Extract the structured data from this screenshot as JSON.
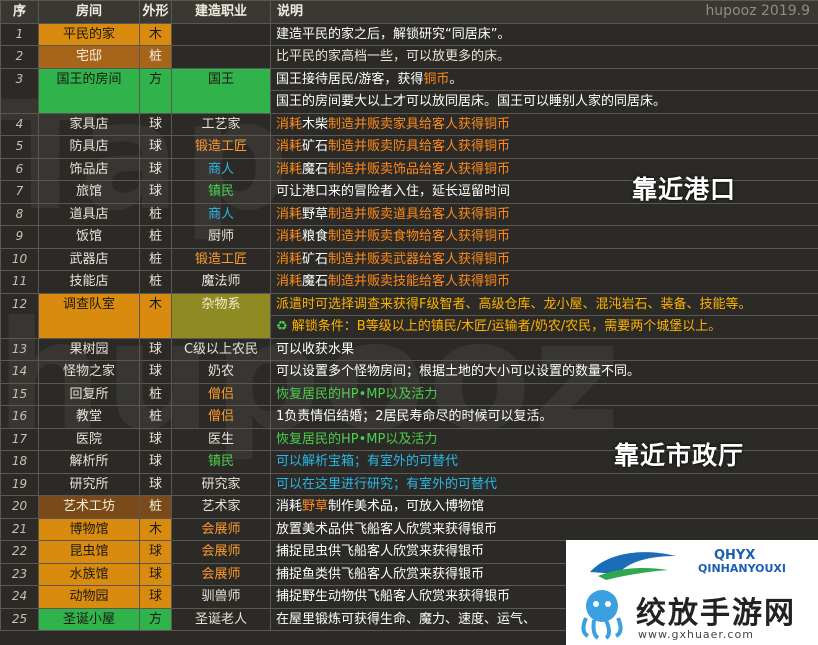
{
  "brand": "hupooz 2019.9",
  "headers": {
    "no": "序",
    "room": "房间",
    "shape": "外形",
    "job": "建造职业",
    "desc": "说明"
  },
  "rows": [
    {
      "no": "1",
      "room": "平民的家",
      "shape": "木",
      "job": "",
      "desc": "建造平民的家之后，解锁研究“同居床”。"
    },
    {
      "no": "2",
      "room": "宅邸",
      "shape": "桩",
      "job": "",
      "desc": "比平民的家高档一些，可以放更多的床。"
    },
    {
      "no": "3",
      "room": "国王的房间",
      "shape": "方",
      "job": "国王",
      "desc_a": "国王接待居民/游客，获得",
      "desc_b": "铜币",
      "desc_c": "。",
      "desc2": "国王的房间要大以上才可以放同居床。国王可以睡别人家的同居床。"
    },
    {
      "no": "4",
      "room": "家具店",
      "shape": "球",
      "job": "工艺家",
      "desc_a": "消耗",
      "desc_b": "木柴",
      "desc_c": "制造并贩卖家具给客人获得铜币"
    },
    {
      "no": "5",
      "room": "防具店",
      "shape": "球",
      "job": "锻造工匠",
      "desc_a": "消耗",
      "desc_b": "矿石",
      "desc_c": "制造并贩卖防具给客人获得铜币"
    },
    {
      "no": "6",
      "room": "饰品店",
      "shape": "球",
      "job": "商人",
      "desc_a": "消耗",
      "desc_b": "魔石",
      "desc_c": "制造并贩卖饰品给客人获得铜币"
    },
    {
      "no": "7",
      "room": "旅馆",
      "shape": "球",
      "job": "镇民",
      "desc": "可让港口来的冒险者入住，延长逗留时间"
    },
    {
      "no": "8",
      "room": "道具店",
      "shape": "桩",
      "job": "商人",
      "desc_a": "消耗",
      "desc_b": "野草",
      "desc_c": "制造并贩卖道具给客人获得铜币"
    },
    {
      "no": "9",
      "room": "饭馆",
      "shape": "桩",
      "job": "厨师",
      "desc_a": "消耗",
      "desc_b": "粮食",
      "desc_c": "制造并贩卖食物给客人获得铜币"
    },
    {
      "no": "10",
      "room": "武器店",
      "shape": "桩",
      "job": "锻造工匠",
      "desc_a": "消耗",
      "desc_b": "矿石",
      "desc_c": "制造并贩卖武器给客人获得铜币"
    },
    {
      "no": "11",
      "room": "技能店",
      "shape": "桩",
      "job": "魔法师",
      "desc_a": "消耗",
      "desc_b": "魔石",
      "desc_c": "制造并贩卖技能给客人获得铜币"
    },
    {
      "no": "12",
      "room": "调查队室",
      "shape": "木",
      "job": "杂物系",
      "desc": "派遣时可选择调查来获得F级智者、高级仓库、龙小屋、混沌岩石、装备、技能等。",
      "desc2_icon": "♻",
      "desc2": "解锁条件：B等级以上的镇民/木匠/运输者/奶农/农民，需要两个城堡以上。"
    },
    {
      "no": "13",
      "room": "果树园",
      "shape": "球",
      "job": "C级以上农民",
      "desc": "可以收获水果"
    },
    {
      "no": "14",
      "room": "怪物之家",
      "shape": "球",
      "job": "奶农",
      "desc": "可以设置多个怪物房间；根据土地的大小可以设置的数量不同。"
    },
    {
      "no": "15",
      "room": "回复所",
      "shape": "桩",
      "job": "僧侣",
      "desc": "恢复居民的HP•MP以及活力"
    },
    {
      "no": "16",
      "room": "教堂",
      "shape": "桩",
      "job": "僧侣",
      "desc": "1负责情侣结婚；2居民寿命尽的时候可以复活。"
    },
    {
      "no": "17",
      "room": "医院",
      "shape": "球",
      "job": "医生",
      "desc": "恢复居民的HP•MP以及活力"
    },
    {
      "no": "18",
      "room": "解析所",
      "shape": "球",
      "job": "镇民",
      "desc": "可以解析宝箱；有室外的可替代"
    },
    {
      "no": "19",
      "room": "研究所",
      "shape": "球",
      "job": "研究家",
      "desc": "可以在这里进行研究；有室外的可替代"
    },
    {
      "no": "20",
      "room": "艺术工坊",
      "shape": "桩",
      "job": "艺术家",
      "desc_a": "消耗",
      "desc_b": "野草",
      "desc_c": "制作美术品，可放入博物馆"
    },
    {
      "no": "21",
      "room": "博物馆",
      "shape": "木",
      "job": "会展师",
      "desc": "放置美术品供飞船客人欣赏来获得银币"
    },
    {
      "no": "22",
      "room": "昆虫馆",
      "shape": "球",
      "job": "会展师",
      "desc": "捕捉昆虫供飞船客人欣赏来获得银币"
    },
    {
      "no": "23",
      "room": "水族馆",
      "shape": "球",
      "job": "会展师",
      "desc": "捕捉鱼类供飞船客人欣赏来获得银币"
    },
    {
      "no": "24",
      "room": "动物园",
      "shape": "球",
      "job": "驯兽师",
      "desc": "捕捉野生动物供飞船客人欣赏来获得银币"
    },
    {
      "no": "25",
      "room": "圣诞小屋",
      "shape": "方",
      "job": "圣诞老人",
      "desc": "在屋里锻炼可获得生命、魔力、速度、运气、"
    }
  ],
  "overlays": {
    "port": "靠近港口",
    "city": "靠近市政厅"
  },
  "watermark": {
    "line1": "Tap",
    "line2": "hupooz"
  },
  "logo": {
    "hx": "QHYX",
    "en": "QINHANYOUXI",
    "cn": "绞放手游网",
    "url": "www.gxhuaer.com"
  },
  "colors": {
    "orange_fill": "#d98b10",
    "green_fill": "#2fb34a",
    "brown_fill": "#a7641b",
    "accent_orange": "#ff8a1a",
    "accent_cyan": "#29b9e8"
  }
}
